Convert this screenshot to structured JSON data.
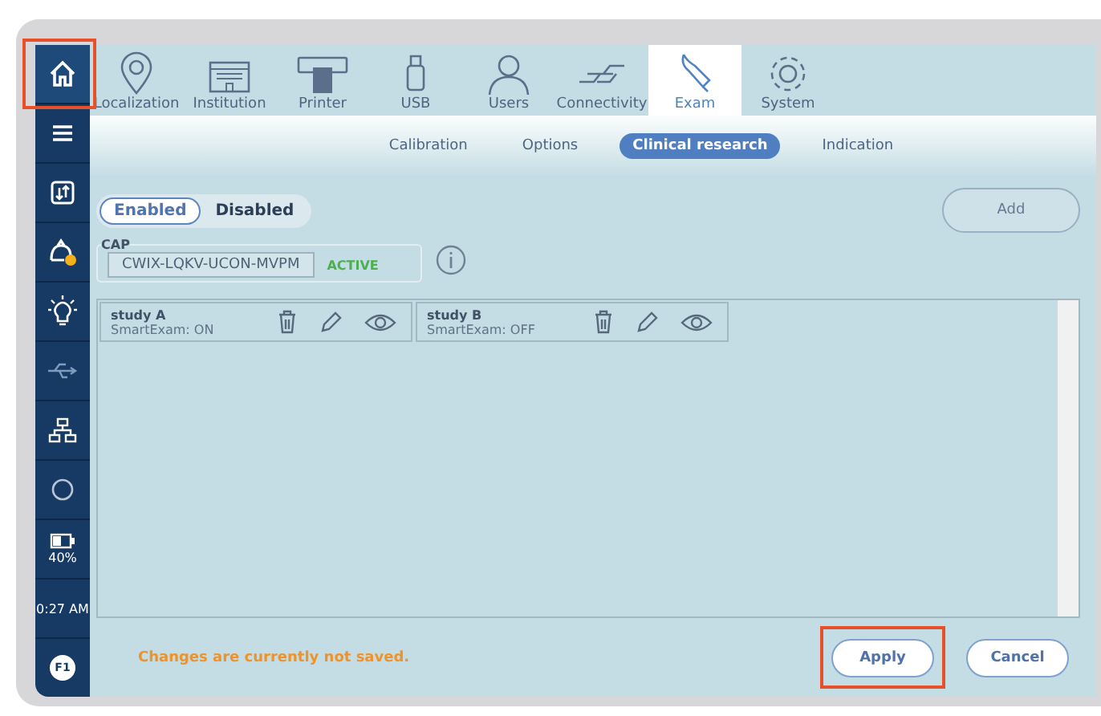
{
  "sidebar": {
    "items": [
      {
        "kind": "home",
        "selected": true
      },
      {
        "kind": "menu",
        "selected": false
      },
      {
        "kind": "transfer",
        "selected": false
      },
      {
        "kind": "operator",
        "selected": false
      },
      {
        "kind": "light",
        "selected": false
      },
      {
        "kind": "usb",
        "selected": false
      },
      {
        "kind": "network",
        "selected": false
      },
      {
        "kind": "record",
        "selected": false
      },
      {
        "kind": "battery",
        "label": "40%",
        "selected": false
      },
      {
        "kind": "clock",
        "label": "0:27 AM",
        "selected": false
      },
      {
        "kind": "badge",
        "label": "F1",
        "selected": false
      }
    ]
  },
  "tabs": [
    {
      "label": "Localization",
      "kind": "pin",
      "selected": false
    },
    {
      "label": "Institution",
      "kind": "building",
      "selected": false
    },
    {
      "label": "Printer",
      "kind": "printer",
      "selected": false
    },
    {
      "label": "USB",
      "kind": "usb",
      "selected": false
    },
    {
      "label": "Users",
      "kind": "user",
      "selected": false
    },
    {
      "label": "Connectivity",
      "kind": "plug",
      "selected": false
    },
    {
      "label": "Exam",
      "kind": "probe",
      "selected": true
    },
    {
      "label": "System",
      "kind": "gear",
      "selected": false
    }
  ],
  "subtabs": [
    {
      "label": "Calibration",
      "selected": false
    },
    {
      "label": "Options",
      "selected": false
    },
    {
      "label": "Clinical research",
      "selected": true
    },
    {
      "label": "Indication",
      "selected": false
    }
  ],
  "mode_toggle": [
    {
      "label": "Enabled",
      "selected": true
    },
    {
      "label": "Disabled",
      "selected": false
    }
  ],
  "add_button": "Add",
  "cap": {
    "legend": "CAP",
    "code": "CWIX-LQKV-UCON-MVPM",
    "status": "ACTIVE"
  },
  "studies": [
    {
      "name": "study A",
      "detail": "SmartExam: ON"
    },
    {
      "name": "study B",
      "detail": "SmartExam: OFF"
    }
  ],
  "footer": {
    "message": "Changes are currently not saved.",
    "buttons": [
      "Apply",
      "Cancel"
    ]
  }
}
